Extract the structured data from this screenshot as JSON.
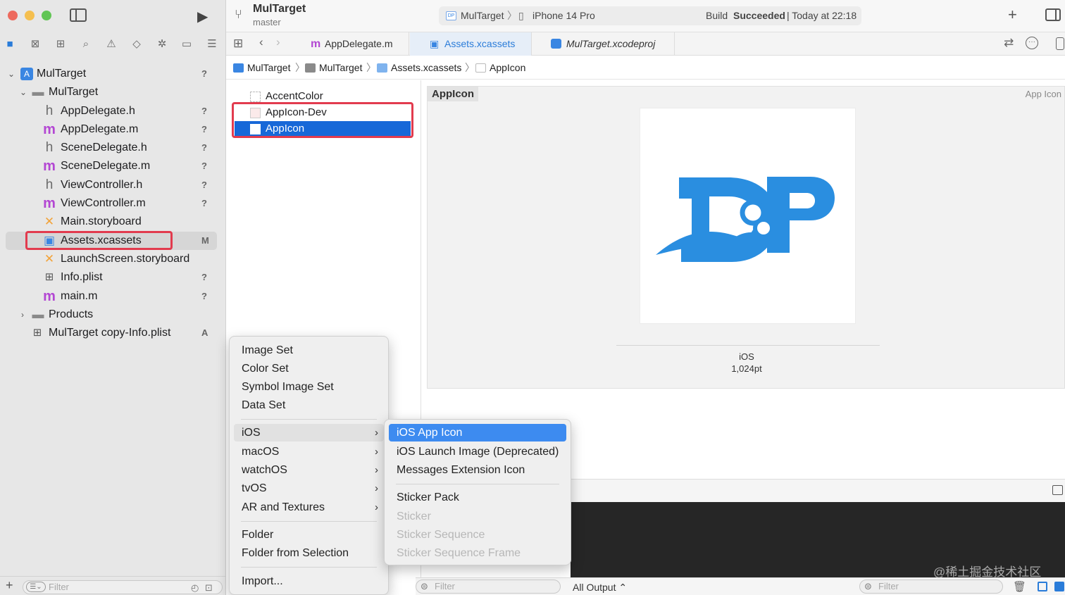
{
  "window": {
    "project_name": "MulTarget",
    "branch": "master"
  },
  "toolbar": {
    "scheme": "MulTarget",
    "device": "iPhone 14 Pro",
    "status_prefix": "Build",
    "status_bold": "Succeeded",
    "status_time": "| Today at 22:18"
  },
  "tabs": [
    {
      "label": "AppDelegate.m",
      "icon": "m"
    },
    {
      "label": "Assets.xcassets"
    },
    {
      "label": "MulTarget.xcodeproj"
    }
  ],
  "jumpbar": [
    "MulTarget",
    "MulTarget",
    "Assets.xcassets",
    "AppIcon"
  ],
  "navigator": {
    "items": [
      {
        "label": "MulTarget",
        "status": "?"
      },
      {
        "label": "MulTarget"
      },
      {
        "label": "AppDelegate.h",
        "icon": "h",
        "status": "?"
      },
      {
        "label": "AppDelegate.m",
        "icon": "m",
        "status": "?"
      },
      {
        "label": "SceneDelegate.h",
        "icon": "h",
        "status": "?"
      },
      {
        "label": "SceneDelegate.m",
        "icon": "m",
        "status": "?"
      },
      {
        "label": "ViewController.h",
        "icon": "h",
        "status": "?"
      },
      {
        "label": "ViewController.m",
        "icon": "m",
        "status": "?"
      },
      {
        "label": "Main.storyboard"
      },
      {
        "label": "Assets.xcassets",
        "status": "M"
      },
      {
        "label": "LaunchScreen.storyboard"
      },
      {
        "label": "Info.plist",
        "status": "?"
      },
      {
        "label": "main.m",
        "icon": "m",
        "status": "?"
      },
      {
        "label": "Products"
      },
      {
        "label": "MulTarget copy-Info.plist",
        "status": "A"
      }
    ],
    "filter_placeholder": "Filter"
  },
  "assets": [
    "AccentColor",
    "AppIcon-Dev",
    "AppIcon"
  ],
  "detail": {
    "title": "AppIcon",
    "tag": "App Icon",
    "platform": "iOS",
    "size": "1,024pt"
  },
  "menu_main": {
    "group1": [
      "Image Set",
      "Color Set",
      "Symbol Image Set",
      "Data Set"
    ],
    "group2": [
      "iOS",
      "macOS",
      "watchOS",
      "tvOS",
      "AR and Textures"
    ],
    "group3": [
      "Folder",
      "Folder from Selection"
    ],
    "group4": [
      "Import..."
    ]
  },
  "menu_ios": {
    "group1": [
      "iOS App Icon",
      "iOS Launch Image (Deprecated)",
      "Messages Extension Icon"
    ],
    "group2": [
      "Sticker Pack",
      "Sticker",
      "Sticker Sequence",
      "Sticker Sequence Frame"
    ]
  },
  "bottom": {
    "filter_placeholder": "Filter",
    "output_selector": "All Output ⌃",
    "console_filter_placeholder": "Filter"
  },
  "watermark": "@稀土掘金技术社区",
  "colors": {
    "selection": "#1768d8",
    "highlight": "#3d8bf0",
    "annotation": "#e23b4e",
    "logo": "#2a8ee0"
  }
}
